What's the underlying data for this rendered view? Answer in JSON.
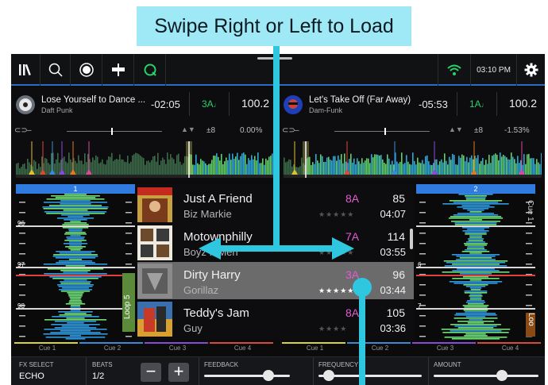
{
  "callout": {
    "text": "Swipe Right or Left to Load"
  },
  "topbar": {
    "icons": [
      "library-icon",
      "search-icon",
      "record-icon",
      "eq-fader-icon",
      "q-icon"
    ],
    "clock": "03:10 PM",
    "icons_right": [
      "wifi-icon",
      "gear-icon"
    ]
  },
  "deck_left": {
    "title": "Lose Yourself to Dance ...",
    "artist": "Daft Punk",
    "time": "-02:05",
    "key": "3A",
    "bpm": "100.2",
    "loop": "–",
    "pitch_range": "±8",
    "pitch": "0.00%",
    "deck_number": "1"
  },
  "deck_right": {
    "title": "Let's Take Off (Far Away)",
    "artist": "Dam-Funk",
    "time": "-05:53",
    "key": "1A",
    "bpm": "100.2",
    "loop": "–",
    "pitch_range": "±8",
    "pitch": "-1.53%",
    "deck_number": "2"
  },
  "left_wave_labels": {
    "m1": "96",
    "m2": "97",
    "m3": "98",
    "loop": "Loop 5"
  },
  "right_wave_labels": {
    "m1": "6",
    "m2": "7",
    "cue": "Cue 1",
    "loop": "Loo"
  },
  "tracks": [
    {
      "title": "Just A Friend",
      "artist": "Biz Markie",
      "key": "8A",
      "bpm": "85",
      "time": "04:07",
      "stars": "★★★★★"
    },
    {
      "title": "Motownphilly",
      "artist": "Boyz II Men",
      "key": "7A",
      "bpm": "114",
      "time": "03:55",
      "stars": "★★★★★"
    },
    {
      "title": "Dirty Harry",
      "artist": "Gorillaz",
      "key": "3A",
      "bpm": "96",
      "time": "03:44",
      "stars": "★★★★★"
    },
    {
      "title": "Teddy's Jam",
      "artist": "Guy",
      "key": "8A",
      "bpm": "105",
      "time": "03:36",
      "stars": "★★★★"
    }
  ],
  "cues_left": [
    "Cue 1",
    "Cue 2",
    "Cue 3",
    "Cue 4"
  ],
  "cues_right": [
    "Cue 1",
    "Cue 2",
    "Cue 3",
    "Cue 4"
  ],
  "fx": {
    "select_label": "FX SELECT",
    "select_value": "ECHO",
    "beats_label": "BEATS",
    "beats_value": "1/2",
    "minus": "−",
    "plus": "+",
    "feedback_label": "FEEDBACK",
    "frequency_label": "FREQUENCY",
    "amount_label": "AMOUNT",
    "feedback_level": 0.75,
    "frequency_level": 0.1,
    "amount_level": 0.65
  },
  "colors": {
    "accent": "#2f7be0",
    "key_green": "#2ad16a",
    "key_magenta": "#e25bd5",
    "callout": "#9fe9f6"
  }
}
